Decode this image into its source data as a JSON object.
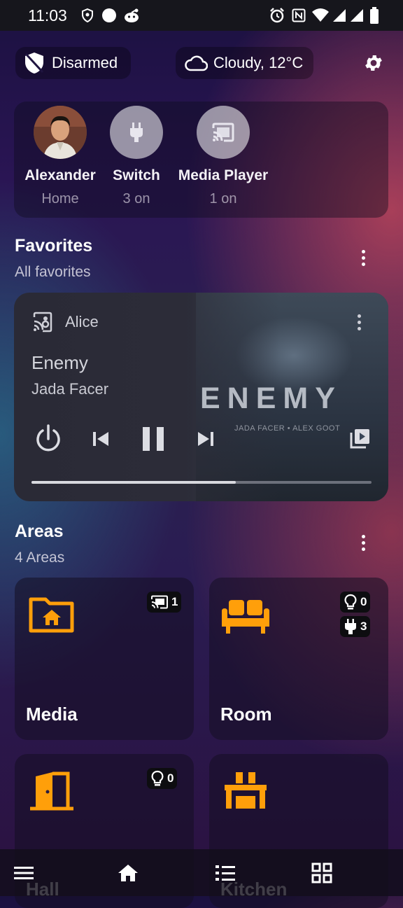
{
  "status_bar": {
    "time": "11:03",
    "left_icons": [
      "shield-icon",
      "circle-icon",
      "reddit-icon"
    ],
    "right_icons": [
      "alarm-icon",
      "nfc-icon",
      "wifi-icon",
      "signal-icon",
      "signal-icon",
      "battery-icon"
    ]
  },
  "header": {
    "alarm_label": "Disarmed",
    "weather_label": "Cloudy, 12°C"
  },
  "persons": [
    {
      "name": "Alexander",
      "state": "Home",
      "icon": "avatar"
    },
    {
      "name": "Switch",
      "state": "3 on",
      "icon": "plug-icon"
    },
    {
      "name": "Media Player",
      "state": "1 on",
      "icon": "cast-icon"
    }
  ],
  "favorites": {
    "title": "Favorites",
    "subtitle": "All favorites"
  },
  "media_player": {
    "source": "Alice",
    "track": "Enemy",
    "artist": "Jada Facer",
    "art_title": "ENEMY",
    "art_subtitle": "JADA FACER • ALEX GOOT",
    "progress": 0.6
  },
  "areas": {
    "title": "Areas",
    "subtitle": "4 Areas",
    "items": [
      {
        "name": "Media",
        "icon": "folder-home-icon",
        "badges": [
          {
            "icon": "cast-icon",
            "count": "1"
          }
        ]
      },
      {
        "name": "Room",
        "icon": "sofa-icon",
        "badges": [
          {
            "icon": "bulb-icon",
            "count": "0"
          },
          {
            "icon": "plug-icon",
            "count": "3"
          }
        ]
      },
      {
        "name": "Hall",
        "icon": "door-icon",
        "badges": [
          {
            "icon": "bulb-icon",
            "count": "0"
          }
        ]
      },
      {
        "name": "Kitchen",
        "icon": "table-icon",
        "badges": []
      }
    ]
  },
  "colors": {
    "accent": "#ff9f0a",
    "card": "#1e1a2e"
  },
  "nav": [
    "menu-icon",
    "home-icon",
    "list-icon",
    "grid-icon"
  ]
}
